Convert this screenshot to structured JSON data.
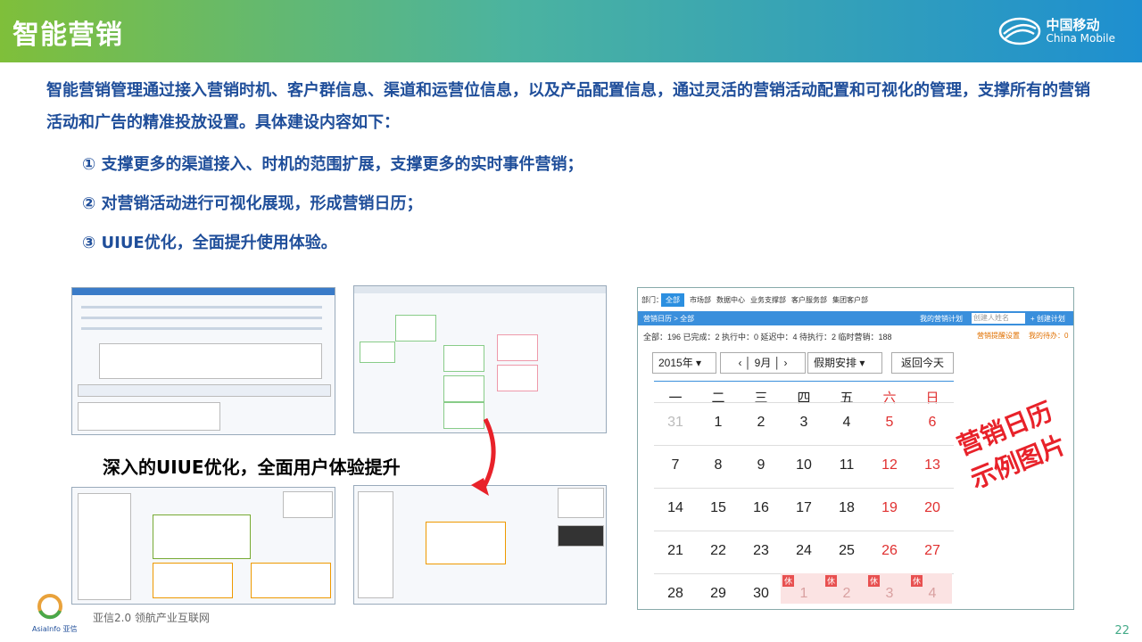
{
  "header": {
    "title": "智能营销",
    "logo_cn": "中国移动",
    "logo_en": "China Mobile"
  },
  "intro": "智能营销管理通过接入营销时机、客户群信息、渠道和运营位信息，以及产品配置信息，通过灵活的营销活动配置和可视化的管理，支撑所有的营销活动和广告的精准投放设置。具体建设内容如下：",
  "items": [
    "① 支撑更多的渠道接入、时机的范围扩展，支撑更多的实时事件营销；",
    "② 对营销活动进行可视化展现，形成营销日历；",
    "③ UIUE优化，全面提升使用体验。"
  ],
  "caption": "深入的UIUE优化，全面用户体验提升",
  "calendar": {
    "tabs": [
      "部门：",
      "全部",
      "市场部",
      "数据中心",
      "业务支撑部",
      "客户服务部",
      "集团客户部"
    ],
    "nav": "营销日历 > 全部",
    "my_plan": "我的营销计划",
    "search_placeholder": "创建人姓名",
    "create": "+ 创建计划",
    "stats": "全部：196  已完成：2  执行中：0  延迟中：4  待执行：2  临时营销：188",
    "settings": "营销提醒设置",
    "todo": "我的待办：0",
    "year": "2015年",
    "month": "9月",
    "mode": "假期安排",
    "today": "返回今天",
    "weekdays": [
      "一",
      "二",
      "三",
      "四",
      "五",
      "六",
      "日"
    ],
    "weeks": [
      [
        "31",
        "1",
        "2",
        "3",
        "4",
        "5",
        "6"
      ],
      [
        "7",
        "8",
        "9",
        "10",
        "11",
        "12",
        "13"
      ],
      [
        "14",
        "15",
        "16",
        "17",
        "18",
        "19",
        "20"
      ],
      [
        "21",
        "22",
        "23",
        "24",
        "25",
        "26",
        "27"
      ],
      [
        "28",
        "29",
        "30",
        "1",
        "2",
        "3",
        "4"
      ]
    ],
    "holiday_mark": "休"
  },
  "stamp": {
    "line1": "营销日历",
    "line2": "示例图片"
  },
  "footer": {
    "brand": "AsiaInfo 亚信",
    "slogan": "亚信2.0  领航产业互联网",
    "page": "22"
  }
}
